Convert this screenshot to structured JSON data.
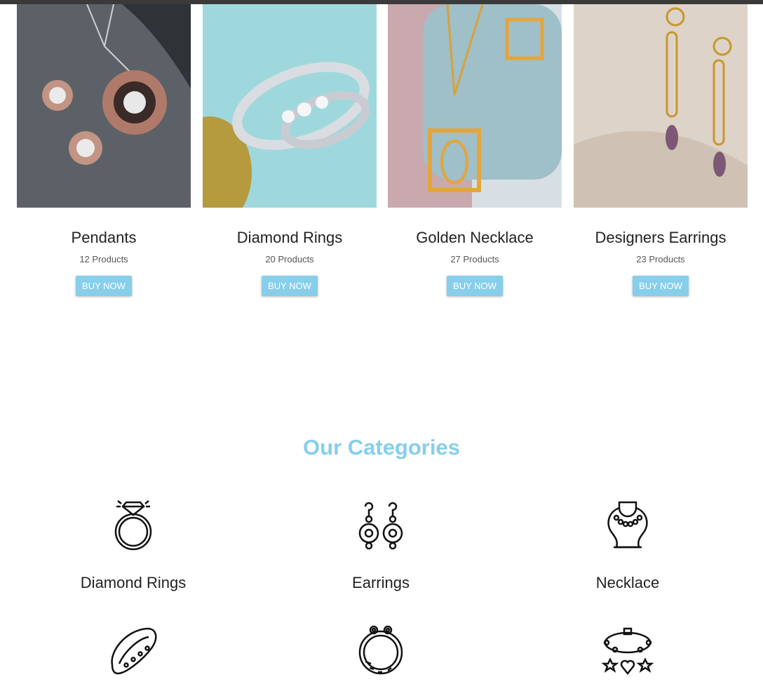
{
  "products": [
    {
      "title": "Pendants",
      "count": "12 Products",
      "button": "BUY NOW"
    },
    {
      "title": "Diamond Rings",
      "count": "20 Products",
      "button": "BUY NOW"
    },
    {
      "title": "Golden Necklace",
      "count": "27 Products",
      "button": "BUY NOW"
    },
    {
      "title": "Designers Earrings",
      "count": "23 Products",
      "button": "BUY NOW"
    }
  ],
  "categories_section": {
    "title": "Our Categories",
    "accent_color": "#87ceeb",
    "items": [
      {
        "label": "Diamond Rings",
        "icon": "diamond-ring-icon"
      },
      {
        "label": "Earrings",
        "icon": "earrings-icon"
      },
      {
        "label": "Necklace",
        "icon": "necklace-icon"
      },
      {
        "label": "",
        "icon": "bangle-icon"
      },
      {
        "label": "",
        "icon": "bracelet-icon"
      },
      {
        "label": "",
        "icon": "charm-bracelet-icon"
      }
    ]
  }
}
